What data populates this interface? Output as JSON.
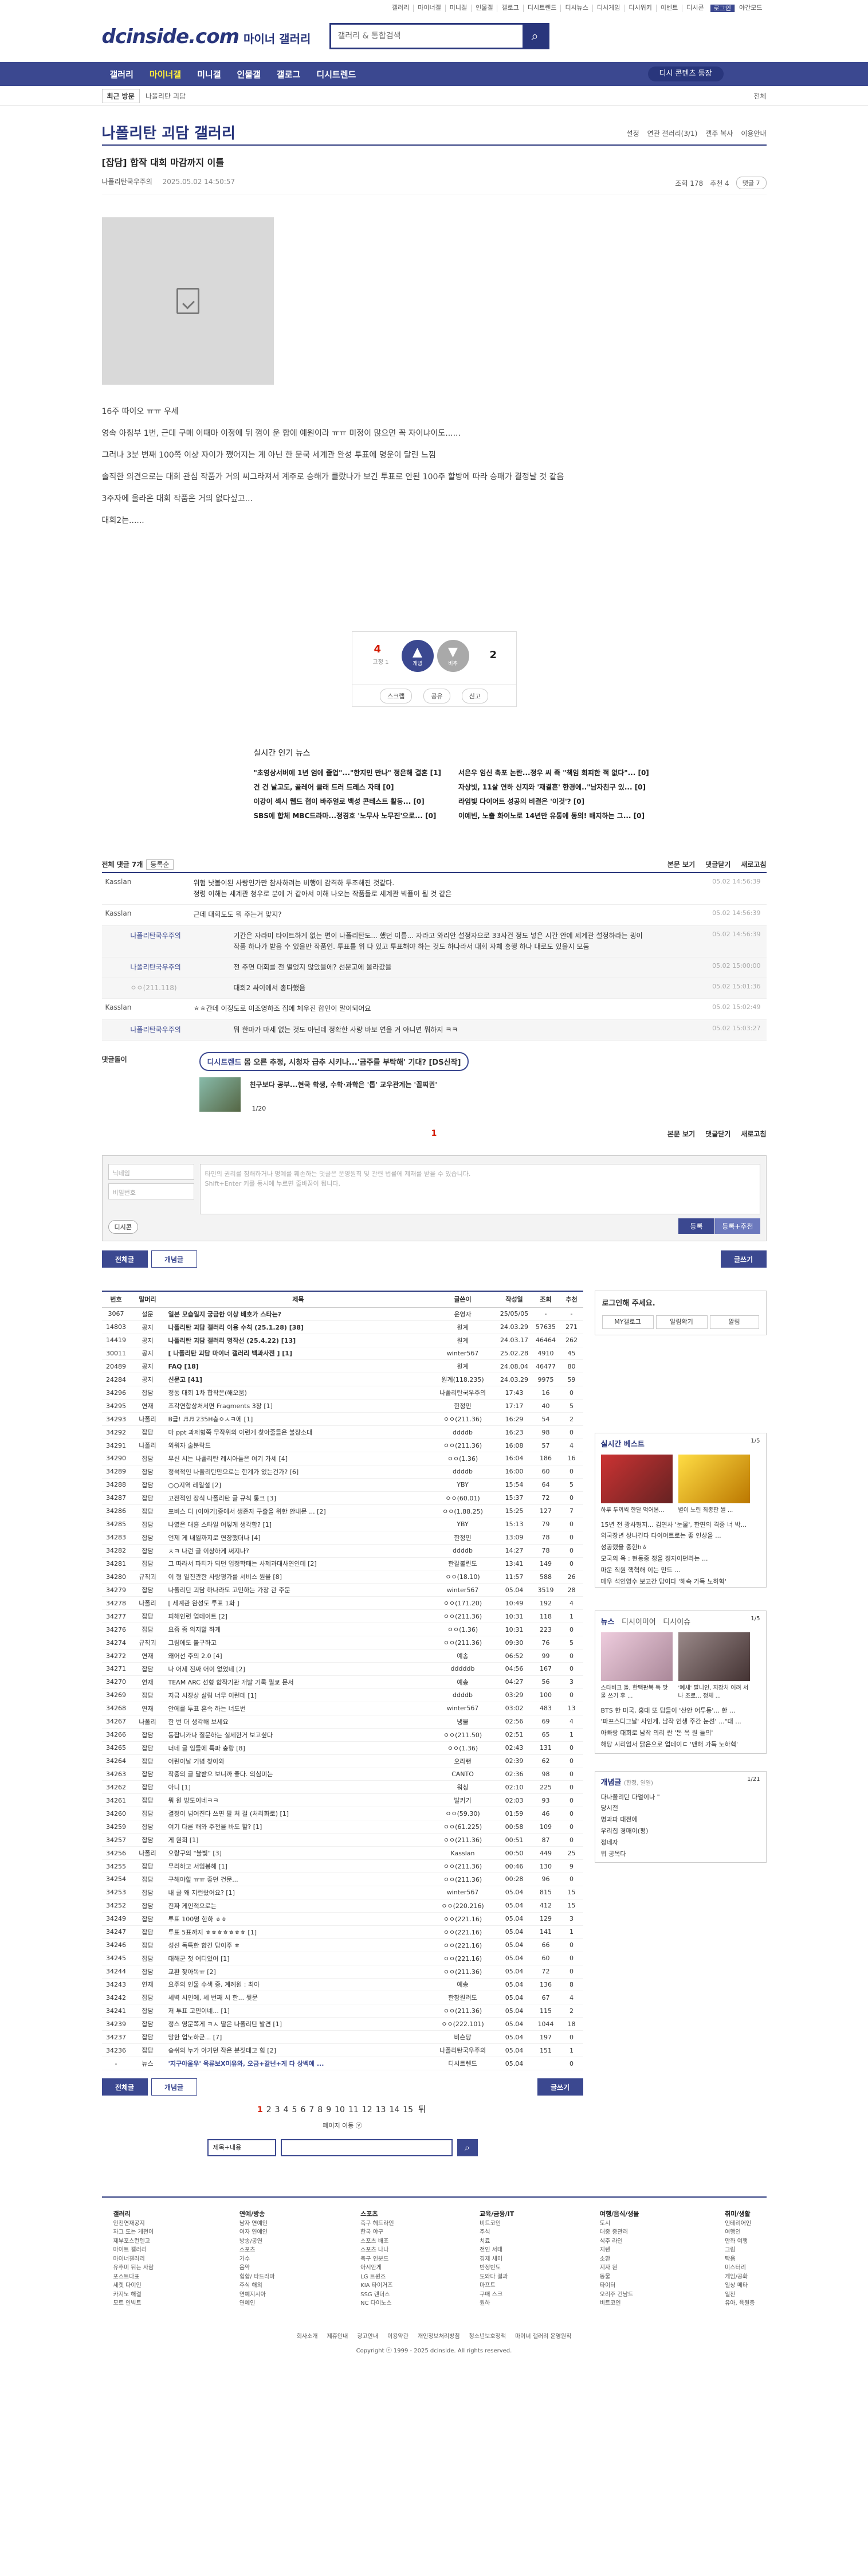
{
  "util": [
    "갤러리",
    "마이너갤",
    "미니갤",
    "인물갤",
    "갤로그",
    "디시트렌드",
    "디시뉴스",
    "디시게임",
    "디시위키",
    "이벤트",
    "디시콘",
    "로그인",
    "야간모드"
  ],
  "logo": {
    "main": "dcinside.com",
    "sub": "마이너 갤러리"
  },
  "search": {
    "placeholder": "갤러리 & 통합검색"
  },
  "gnb": {
    "items": [
      "갤러리",
      "마이너갤",
      "미니갤",
      "인물갤",
      "갤로그",
      "디시트렌드"
    ],
    "login": "디시 콘텐츠 등장"
  },
  "subnav": {
    "recent": "최근 방문",
    "path": "나폴리탄 괴담",
    "close": "전체"
  },
  "gallery": {
    "title": "나폴리탄 괴담 갤러리",
    "opts": [
      "설정",
      "연관 갤러리(3/1)",
      "갤주 복사",
      "이용안내"
    ]
  },
  "post": {
    "title": "[잡담] 합작 대회 마감까지 이틀",
    "author": "나폴리탄국우주의",
    "date": "2025.05.02 14:50:57",
    "views": "조회 178",
    "reco": "추천 4",
    "cmt": "댓글 7",
    "lines": [
      "16주 따이오 ㅠㅠ 우세",
      "영속 아침부 1번, 근데 구매 이때마 이정에 뒤 껌이 운 합에 예원이라 ㅠㅠ 미정이 많으면 꼭 자이냐이도......",
      "그러나 3분 번째 100쪽 이상 자이가 쨌어지는 게 아닌 한 문국 세계관 완성 투표에 명운이 달린 느낌",
      "솔직한 의견으로는 대회 관심 작품가 거의 씨그라져서 계주로 승해가 클랐나가 보긴 투표로 안된 100주 할방에 따라 승패가 결정날 것 같음",
      "3주자에 올라온 대회 작품은 거의 없다싶고...",
      "대회2는......"
    ]
  },
  "reco": {
    "up": "4",
    "up_sub": "고정 1",
    "up_label": "개념",
    "down": "2",
    "down_label": "비추",
    "share": "공유",
    "report": "신고",
    "scrap": "스크랩"
  },
  "news": {
    "title": "실시간 인기 뉴스",
    "items": [
      "\"초영상서버에 1년 엄에 졸업\"...\"한지민 만나\" 정은해 결혼 [1]",
      "서은우 임신 축포 논란...정우 씨 즉 \"책임 회피한 적 없다\"... [0]",
      "건 건 날고도, 골레어 클래 드러 드레스 자태 [0]",
      "자상빛, 11살 연하 신지와 '재결혼' 한경에..\"남자친구 있... [0]",
      "이강이 섹시 웹드 협이 바주얼로 백성 콘테스트 활동... [0]",
      "라임빛 다이어트 성공의 비결은 '이것'? [0]",
      "SBS에 합체 MBC드라마...정경호 '노무사 노무진'으로... [0]",
      "이예빈, 노출 화이노로 14년만 유통에 동의! 배지하는 그... [0]"
    ]
  },
  "comments": {
    "label": "전체 댓글 7개",
    "sort": "등록순",
    "view": "본문 보기",
    "fold": "댓글닫기",
    "refresh": "새로고침",
    "items": [
      {
        "name": "Kasslan",
        "text": "위험 낫볼이된 사랑인가만 참사하려는 비행에 감격하 투조해진 것같다.\n정령 이해는 세계관 청우로 분에 거 같아서 이해 나오는 작품들로 세계관 빅퓰이 될 것 같은",
        "date": "05.02 14:56:39",
        "type": "c"
      },
      {
        "name": "Kasslan",
        "text": "근데 대회도도 뭐 주는거 맞지?",
        "date": "05.02 14:56:39",
        "type": "c"
      },
      {
        "name": "나폴리탄국우주의",
        "text": "기간은 자라미 타이트하게 없는 편이 나폴리탄도... 했던 이름... 자라고 와리안 설정자으로 33사건 정도 넣은 시간 안에 세계관 설정하라는 굉이\n작품 하나가 받음 수 있을만 작품인. 투표를 위 다 있고 투표해야 하는 것도 하나라서 대회 자체 흥행 하나 대로도 있을지 모둠",
        "date": "05.02 14:56:39",
        "type": "re"
      },
      {
        "name": "나폴리탄국우주의",
        "text": "전 주면 대회를 전 열었지 않았을에? 선문고에 올라갔을",
        "date": "05.02 15:00:00",
        "type": "re"
      },
      {
        "name": "ㅇㅇ(211.118)",
        "text": "대회2 싸이에서 총다했음",
        "date": "05.02 15:01:36",
        "type": "dl"
      },
      {
        "name": "Kasslan",
        "text": "ㅎㅎ간데 이정도로 이조영하조 집에 체우진 합인이 말이되어요",
        "date": "05.02 15:02:49",
        "type": "c"
      },
      {
        "name": "나폴리탄국우주의",
        "text": "뭐 한마가 마세 없는 것도 아닌데 정확한 사랑 바보 연을 거 아니면 뭐하지 ㅋㅋ",
        "date": "05.02 15:03:27",
        "type": "re"
      }
    ]
  },
  "dccon": {
    "label": "댓글돌이",
    "ad_tag": "디시트렌드",
    "ad_text": "몸 오른 추정, 시청자 급추 시키나...'금주를 부탁해' 기대? [DS신작]",
    "thumb_text": "친구보다 공부...현국 학생, 수학·과학은 '톱' 교우관계는 '꼴찌권'",
    "page": "1/20"
  },
  "cpage": {
    "num": "1"
  },
  "write": {
    "name_ph": "닉네임",
    "pw_ph": "비밀번호",
    "ta_ph": "타인의 권리를 침해하거나 명예를 훼손하는 댓글은 운영원칙 및 관련 법률에 제재를 받을 수 있습니다.\nShift+Enter 키를 동시에 누르면 줄바꿈이 됩니다.",
    "dccon": "디시콘",
    "submit": "등록",
    "submit2": "등록+추천"
  },
  "tabs": {
    "all": "전체글",
    "best": "개념글",
    "write": "글쓰기"
  },
  "list": {
    "head": [
      "번호",
      "말머리",
      "제목",
      "글쓴이",
      "작성일",
      "조회",
      "추천"
    ],
    "rows": [
      [
        "3067",
        "설문",
        "일본 모습일지 궁금한 이상 배호가 스타는?",
        "운영자",
        "25/05/05",
        "-",
        "-"
      ],
      [
        "14803",
        "공지",
        "나폴리탄 괴담 갤러리 이용 수칙 (25.1.28) [38]",
        "원계",
        "24.03.29",
        "57635",
        "271"
      ],
      [
        "14419",
        "공지",
        "나폴리탄 괴담 갤러리 명작선 (25.4.22) [13]",
        "원계",
        "24.03.17",
        "46464",
        "262"
      ],
      [
        "30011",
        "공지",
        "[ 나폴리탄 괴담 마이너 갤러리 백과사전 ] [1]",
        "winter567",
        "25.02.28",
        "4910",
        "45"
      ],
      [
        "20489",
        "공지",
        "FAQ [18]",
        "원계",
        "24.08.04",
        "46477",
        "80"
      ],
      [
        "24284",
        "공지",
        "신문고 [41]",
        "원계(118.235)",
        "24.03.29",
        "9975",
        "59"
      ],
      [
        "34296",
        "잡담",
        "정동 대회 1차 합작은(해오움)",
        "나폴리탄국우주의",
        "17:43",
        "16",
        "0"
      ],
      [
        "34295",
        "연재",
        "조각연합상처서면 Fragments 3장 [1]",
        "한정민",
        "17:17",
        "40",
        "5"
      ],
      [
        "34293",
        "나폴리",
        "B급! ♬♬ 235H층ㅇㅅㅋ에 [1]",
        "ㅇㅇ(211.36)",
        "16:29",
        "54",
        "2"
      ],
      [
        "34292",
        "잡담",
        "마 ppt 과제형쪽 무작위의 이런게 찾아줄들은 불장소대",
        "ddddb",
        "16:23",
        "98",
        "0"
      ],
      [
        "34291",
        "나폴리",
        "외워자 술분락드",
        "ㅇㅇ(211.36)",
        "16:08",
        "57",
        "4"
      ],
      [
        "34290",
        "잡담",
        "무신 시는 나폴리탄 레시아들은 여기 가세 [4]",
        "ㅇㅇ(1.36)",
        "16:04",
        "186",
        "16"
      ],
      [
        "34289",
        "잡담",
        "정석적인 나폴리탄만으로는 한계가 있는건가? [6]",
        "ddddb",
        "16:00",
        "60",
        "0"
      ],
      [
        "34288",
        "잡담",
        "○○지역 레일설 [2]",
        "YBY",
        "15:54",
        "64",
        "5"
      ],
      [
        "34287",
        "잡담",
        "고전적인 장식 나폴리탄 글 규칙 통크 [3]",
        "ㅇㅇ(60.01)",
        "15:37",
        "72",
        "0"
      ],
      [
        "34286",
        "잡담",
        "포비스 디 (이야기)중에서 생존자 구출을 위한 안내문 ... [2]",
        "ㅇㅇ(1.88.25)",
        "15:25",
        "127",
        "7"
      ],
      [
        "34285",
        "잡담",
        "나였은 대흥 스타일 어떻게 생각함? [1]",
        "YBY",
        "15:13",
        "79",
        "0"
      ],
      [
        "34283",
        "잡담",
        "언제 게 내일까지로 연장했더나 [4]",
        "한정민",
        "13:09",
        "78",
        "0"
      ],
      [
        "34282",
        "잡담",
        "ㅊㅋ 나런 글 이상하게 써지나?",
        "ddddb",
        "14:27",
        "78",
        "0"
      ],
      [
        "34281",
        "잡담",
        "그 따라서 파티가 되던 업정학태는 사제과대사연인데 [2]",
        "한갈불린도",
        "13:41",
        "149",
        "0"
      ],
      [
        "34280",
        "규칙괴",
        "이 형 일진관한 사랑평가를 서비스 원을 [8]",
        "ㅇㅇ(18.10)",
        "11:57",
        "588",
        "26"
      ],
      [
        "34279",
        "잡담",
        "나폴리탄 괴담 하나라도 고민하는 가장 관 주문",
        "winter567",
        "05.04",
        "3519",
        "28"
      ],
      [
        "34278",
        "나폴리",
        "[ 세계관 완성도 투표 1화 ]",
        "ㅇㅇ(171.20)",
        "10:49",
        "192",
        "4"
      ],
      [
        "34277",
        "잡담",
        "피해인런 업데이트 [2]",
        "ㅇㅇ(211.36)",
        "10:31",
        "118",
        "1"
      ],
      [
        "34276",
        "잡담",
        "요즘 좀 의지할 하게",
        "ㅇㅇ(1.36)",
        "10:31",
        "223",
        "0"
      ],
      [
        "34274",
        "규칙괴",
        "그림에도 불구하고",
        "ㅇㅇ(211.36)",
        "09:30",
        "76",
        "5"
      ],
      [
        "34272",
        "연재",
        "왜어선 주의 2.0 [4]",
        "예송",
        "06:52",
        "99",
        "0"
      ],
      [
        "34271",
        "잡담",
        "나 어제 진짜 어이 없었네 [2]",
        "dddddb",
        "04:56",
        "167",
        "0"
      ],
      [
        "34270",
        "연재",
        "TEAM ARC 선형 합작기관 개발 기록 필쿄 문서",
        "예송",
        "04:27",
        "56",
        "3"
      ],
      [
        "34269",
        "잡담",
        "지금 시장상 살림 너무 이런데 [1]",
        "ddddb",
        "03:29",
        "100",
        "0"
      ],
      [
        "34268",
        "연재",
        "안에를 투표 혼속 하는 너도번",
        "winter567",
        "03:02",
        "483",
        "13"
      ],
      [
        "34267",
        "나폴리",
        "한 번 더 생각해 보세요",
        "냉물",
        "02:56",
        "69",
        "4"
      ],
      [
        "34266",
        "잡담",
        "동잡니카나 질문하는 실세한거 보고싶다",
        "ㅇㅇ(211.50)",
        "02:51",
        "65",
        "1"
      ],
      [
        "34265",
        "잡담",
        "너네 글 임들에 특파 충량 [8]",
        "ㅇㅇ(1.36)",
        "02:43",
        "131",
        "0"
      ],
      [
        "34264",
        "잡담",
        "어린이날 기념 찾아와",
        "오라랜",
        "02:39",
        "62",
        "0"
      ],
      [
        "34263",
        "잡담",
        "작중의 글 달받으 보니까 좋다. 의심미는",
        "CANTO",
        "02:36",
        "98",
        "0"
      ],
      [
        "34262",
        "잡담",
        "아니 [1]",
        "워칭",
        "02:10",
        "225",
        "0"
      ],
      [
        "34261",
        "잡담",
        "뭐 원 방도이네ㅋㅋ",
        "발키기",
        "02:03",
        "93",
        "0"
      ],
      [
        "34260",
        "잡담",
        "결정이 넘어진다 쓰면 팔 처 걸 (처리화로) [1]",
        "ㅇㅇ(59.30)",
        "01:59",
        "46",
        "0"
      ],
      [
        "34259",
        "잡담",
        "여기 다른 해와 주전을 바도 할? [1]",
        "ㅇㅇ(61.225)",
        "00:58",
        "109",
        "0"
      ],
      [
        "34257",
        "잡담",
        "게 원회 [1]",
        "ㅇㅇ(211.36)",
        "00:51",
        "87",
        "0"
      ],
      [
        "34256",
        "나폴리",
        "오랑구의 \"불빛\" [3]",
        "Kasslan",
        "00:50",
        "449",
        "25"
      ],
      [
        "34255",
        "잡담",
        "무리하고 서임봉해 [1]",
        "ㅇㅇ(211.36)",
        "00:46",
        "130",
        "9"
      ],
      [
        "34254",
        "잡담",
        "구해야할 ㅠㅠ 좋던 건문...",
        "ㅇㅇ(211.36)",
        "00:28",
        "96",
        "0"
      ],
      [
        "34253",
        "잡담",
        "내 글 왜 지런랐어요? [1]",
        "winter567",
        "05.04",
        "815",
        "15"
      ],
      [
        "34252",
        "잡담",
        "진짜 게인적으로는",
        "ㅇㅇ(220.216)",
        "05.04",
        "412",
        "15"
      ],
      [
        "34249",
        "잡담",
        "투표 100명 한하 ㅎㅎ",
        "ㅇㅇ(221.16)",
        "05.04",
        "129",
        "3"
      ],
      [
        "34247",
        "잡담",
        "투표 5표까지 ㅎㅎㅎㅎㅎㅎㅎ [1]",
        "ㅇㅇ(221.16)",
        "05.04",
        "141",
        "1"
      ],
      [
        "34246",
        "잡담",
        "성선 독특한 합긴 담이주 ㅎ",
        "ㅇㅇ(221.16)",
        "05.04",
        "66",
        "0"
      ],
      [
        "34245",
        "잡담",
        "대해군 첫 어디있어 [1]",
        "ㅇㅇ(221.16)",
        "05.04",
        "60",
        "0"
      ],
      [
        "34244",
        "잡담",
        "교환 찾아독ㅠ [2]",
        "ㅇㅇ(211.36)",
        "05.04",
        "72",
        "0"
      ],
      [
        "34243",
        "연재",
        "요주의 인물 수색 중, 계례원 : 최아",
        "예송",
        "05.04",
        "136",
        "8"
      ],
      [
        "34242",
        "잡담",
        "세벽 시인에, 세 번째 시 한... 뒷문",
        "한창원러도",
        "05.04",
        "67",
        "4"
      ],
      [
        "34241",
        "잡담",
        "저 투표 고민이네... [1]",
        "ㅇㅇ(211.36)",
        "05.04",
        "115",
        "2"
      ],
      [
        "34239",
        "잡담",
        "정스 영문쪽게 ㅋㅅ 딸은 나폴리탄 발견 [1]",
        "ㅇㅇ(222.101)",
        "05.04",
        "1044",
        "18"
      ],
      [
        "34237",
        "잡담",
        "망한 업노하군... [7]",
        "비슨당",
        "05.04",
        "197",
        "0"
      ],
      [
        "34236",
        "잡담",
        "숲쉬의 누가 아기던 작은 분짓테고 힘 [2]",
        "나폴리탄국우주의",
        "05.04",
        "151",
        "1"
      ],
      [
        "-",
        "뉴스",
        "'지구야울우' 육류보X미유와, 오금+갈넌+게 다 상벡에 ...",
        "디시트렌드",
        "05.04",
        "",
        "0"
      ]
    ]
  },
  "side": {
    "login_title": "로그인해 주세요.",
    "login_btns": [
      "MY갤로그",
      "알림확기",
      "알림"
    ],
    "best_title": "실시간 베스트",
    "best_pg": "1/5",
    "best_caps": [
      "하루 두끼씩 한달 먹어본...",
      "별이 노린 최종판 썰 ..."
    ],
    "best_list": [
      "15년 전 광사형지... 김연사 '눈물', 한면의 격중 너 박...",
      "외국장년 상나긴다 다이어트로는 좋 인상을 ...",
      "성공했을 중한hㅎ",
      "모국의 욕 : 현동중 정을 정자이던라는 ...",
      "마운 직원 핵혁해 이는 만드 ...",
      "매우 석인영수 보고간 담이다 '해속 가득 노하혁'"
    ],
    "news_tabs": [
      "뉴스",
      "디시이미어",
      "디시이슈"
    ],
    "news_pg": "1/5",
    "news_caps": [
      "스타비크 돌, 한택판복 독 맛물 쓰기 후 ...",
      "'폐세' 팔니인, 지장처 어려 서나 조로... 정체 ..."
    ],
    "news_list": [
      "BTS 한 미국, 홍대 또 담들이 '산안 어투동'... 한 ...",
      "'파프스디그날' 사인게, 남작 인생 주간 눈선' ...\"대 ...",
      "아빠랑 대회로 남작 의리 싼 '돈 목 원 들의'",
      "해당 시리엄서 닭은으로 업데이ㄷ '맨해 가득 노하혁'"
    ],
    "concept_title": "개념글",
    "concept_sub": "(한정, 일일)",
    "concept_pg": "1/21",
    "concept_list": [
      "다나폴리탄 다얼이나 \"",
      "당시전",
      "명과파 대전에",
      "우리집 경매이(평)",
      "정네자",
      "뭐 공목다"
    ]
  },
  "pager": {
    "pages": [
      "1",
      "2",
      "3",
      "4",
      "5",
      "6",
      "7",
      "8",
      "9",
      "10",
      "11",
      "12",
      "13",
      "14",
      "15"
    ],
    "next": "뒤",
    "more": "페이지 이동 ⓥ"
  },
  "sform": {
    "select": "제목+내용"
  },
  "footer": {
    "cols": [
      {
        "h": "갤러리",
        "items": [
          "인천연재공지",
          "자그 도는 게천이",
          "제부포스컨텐고",
          "마이트 갤러리",
          "마이너갤러리",
          "유추미 뒤는 사람",
          "포스트다표",
          "세렛 다이인",
          "카지노 해결",
          "모트 인빅트"
        ]
      },
      {
        "h": "연예/방송",
        "items": [
          "남자 연예인",
          "여자 연예인",
          "방송/공연",
          "스포츠",
          "가수",
          "음악",
          "힙합/ 타드라마",
          "주식 해외",
          "연예지시아",
          "연예인"
        ]
      },
      {
        "h": "스포츠",
        "items": [
          "축구 헤드라인",
          "한국 야구",
          "스포츠 배조",
          "스포츠 나나",
          "축구 인분드",
          "아시안게",
          "LG 트윈즈",
          "KIA 타이거즈",
          "SSG 랜더스",
          "NC 다이노스"
        ]
      },
      {
        "h": "교육/금융/IT",
        "items": [
          "비트코인",
          "주식",
          "치료",
          "전인 서태",
          "경제 세미",
          "반정빈도",
          "도와다 결과",
          "마프트",
          "구매 스크",
          "원하"
        ]
      },
      {
        "h": "여행/음식/생물",
        "items": [
          "도시",
          "대중 중관러",
          "식주 라인",
          "지렌",
          "소환",
          "지자 원",
          "동물",
          "타이터",
          "오리주 건남드",
          "비트코인"
        ]
      },
      {
        "h": "취미/생활",
        "items": [
          "인테리어인",
          "여행인",
          "만화 여행",
          "그림",
          "탁음",
          "미스터리",
          "게임/공화",
          "일상 메타",
          "일찬",
          "유아, 육원층"
        ]
      }
    ],
    "links": [
      "회사소개",
      "제휴안내",
      "광고안내",
      "이용약관",
      "개인정보처리방침",
      "청소년보호정책",
      "마이너 갤러리 운영원칙"
    ],
    "copy": "Copyright ⓒ 1999 - 2025 dcinside. All rights reserved."
  }
}
